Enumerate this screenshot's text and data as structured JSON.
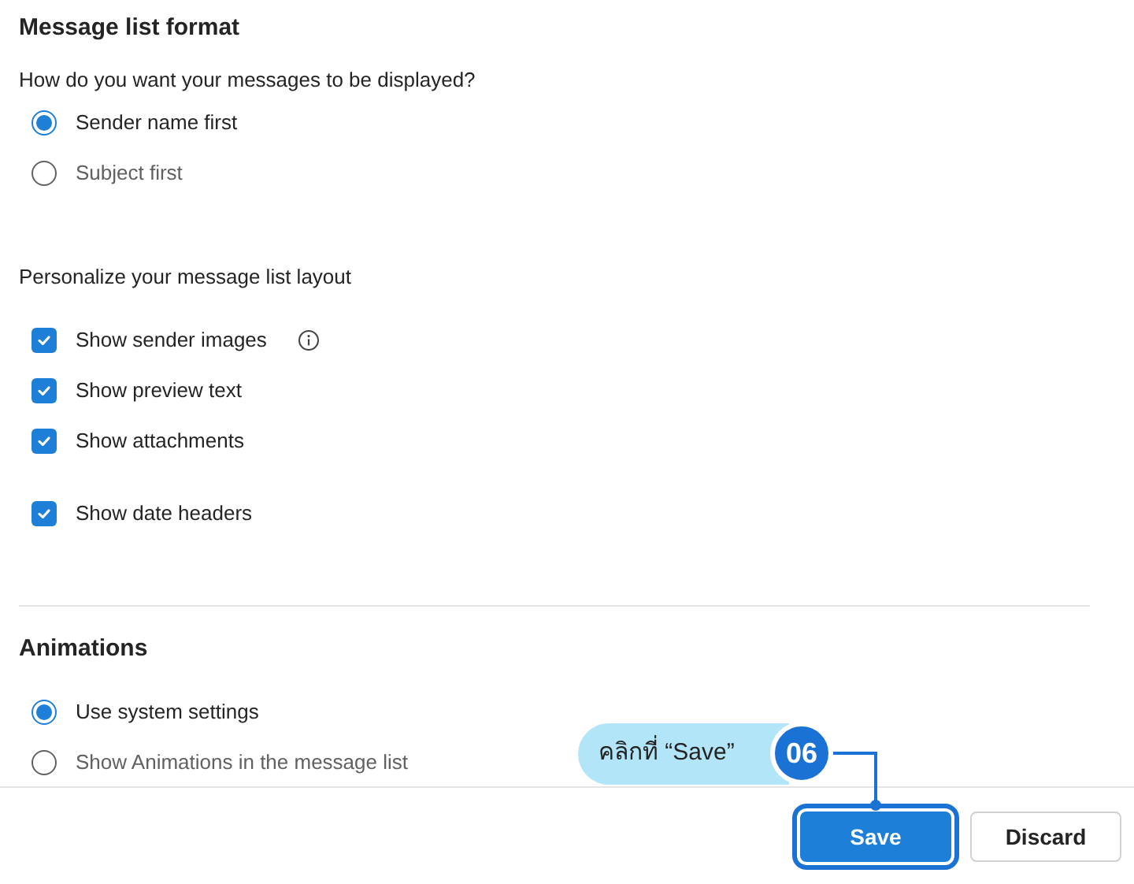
{
  "message_list_format": {
    "title": "Message list format",
    "question": "How do you want your messages to be displayed?",
    "options": [
      {
        "label": "Sender name first",
        "selected": true
      },
      {
        "label": "Subject first",
        "selected": false
      }
    ]
  },
  "layout": {
    "title": "Personalize your message list layout",
    "options": [
      {
        "label": "Show sender images",
        "checked": true,
        "info": true
      },
      {
        "label": "Show preview text",
        "checked": true
      },
      {
        "label": "Show attachments",
        "checked": true
      },
      {
        "label": "Show date headers",
        "checked": true
      }
    ]
  },
  "animations": {
    "title": "Animations",
    "options": [
      {
        "label": "Use system settings",
        "selected": true
      },
      {
        "label": "Show Animations in the message list",
        "selected": false
      }
    ]
  },
  "footer": {
    "buttons": [
      {
        "label": "Save",
        "kind": "primary",
        "highlighted": true
      },
      {
        "label": "Discard",
        "kind": "secondary",
        "highlighted": false
      }
    ]
  },
  "callout": {
    "text": "คลิกที่ “Save”",
    "step": "06"
  }
}
